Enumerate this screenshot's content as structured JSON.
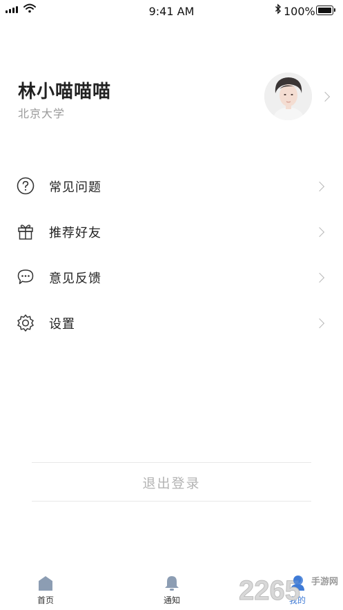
{
  "status_bar": {
    "time": "9:41 AM",
    "battery_percent": "100%",
    "battery_level": 1.0
  },
  "profile": {
    "name": "林小喵喵喵",
    "school": "北京大学"
  },
  "menu": [
    {
      "label": "常见问题",
      "icon": "question-circle-icon"
    },
    {
      "label": "推荐好友",
      "icon": "gift-icon"
    },
    {
      "label": "意见反馈",
      "icon": "chat-bubble-icon"
    },
    {
      "label": "设置",
      "icon": "gear-icon"
    }
  ],
  "logout_label": "退出登录",
  "tab_bar": {
    "home": "首页",
    "notifications": "通知",
    "mine": "我的",
    "active_color": "#3f7bd6",
    "inactive_color": "#8c9db3"
  },
  "watermark": {
    "number": "2265",
    "text": "手游网"
  }
}
